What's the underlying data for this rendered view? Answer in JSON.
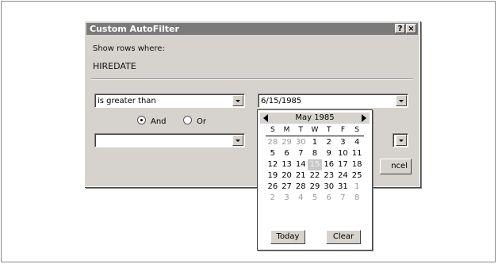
{
  "dialog": {
    "title": "Custom AutoFilter",
    "help_label": "?",
    "close_label": "×",
    "show_rows_label": "Show rows where:",
    "field_name": "HIREDATE",
    "condition1": {
      "operator": "is greater than",
      "value": "6/15/1985"
    },
    "logic": {
      "and_label": "And",
      "or_label": "Or",
      "selected": "And"
    },
    "condition2": {
      "operator": "",
      "value": ""
    },
    "cancel_label": "ncel"
  },
  "calendar": {
    "month_label": "May 1985",
    "weekday_headers": [
      "S",
      "M",
      "T",
      "W",
      "T",
      "F",
      "S"
    ],
    "days": [
      {
        "d": "28",
        "other": true
      },
      {
        "d": "29",
        "other": true
      },
      {
        "d": "30",
        "other": true
      },
      {
        "d": "1"
      },
      {
        "d": "2"
      },
      {
        "d": "3"
      },
      {
        "d": "4"
      },
      {
        "d": "5"
      },
      {
        "d": "6"
      },
      {
        "d": "7"
      },
      {
        "d": "8"
      },
      {
        "d": "9"
      },
      {
        "d": "10"
      },
      {
        "d": "11"
      },
      {
        "d": "12"
      },
      {
        "d": "13"
      },
      {
        "d": "14"
      },
      {
        "d": "15",
        "selected": true
      },
      {
        "d": "16"
      },
      {
        "d": "17"
      },
      {
        "d": "18"
      },
      {
        "d": "19"
      },
      {
        "d": "20"
      },
      {
        "d": "21"
      },
      {
        "d": "22"
      },
      {
        "d": "23"
      },
      {
        "d": "24"
      },
      {
        "d": "25"
      },
      {
        "d": "26"
      },
      {
        "d": "27"
      },
      {
        "d": "28"
      },
      {
        "d": "29"
      },
      {
        "d": "30"
      },
      {
        "d": "31"
      },
      {
        "d": "1",
        "other": true
      },
      {
        "d": "2",
        "other": true
      },
      {
        "d": "3",
        "other": true
      },
      {
        "d": "4",
        "other": true
      },
      {
        "d": "5",
        "other": true
      },
      {
        "d": "6",
        "other": true
      },
      {
        "d": "7",
        "other": true
      },
      {
        "d": "8",
        "other": true
      }
    ],
    "today_label": "Today",
    "clear_label": "Clear"
  },
  "colors": {
    "dialog_face": "#d6d3ce",
    "titlebar": "#7a7a7a",
    "selected_day": "#c8c8c8"
  }
}
